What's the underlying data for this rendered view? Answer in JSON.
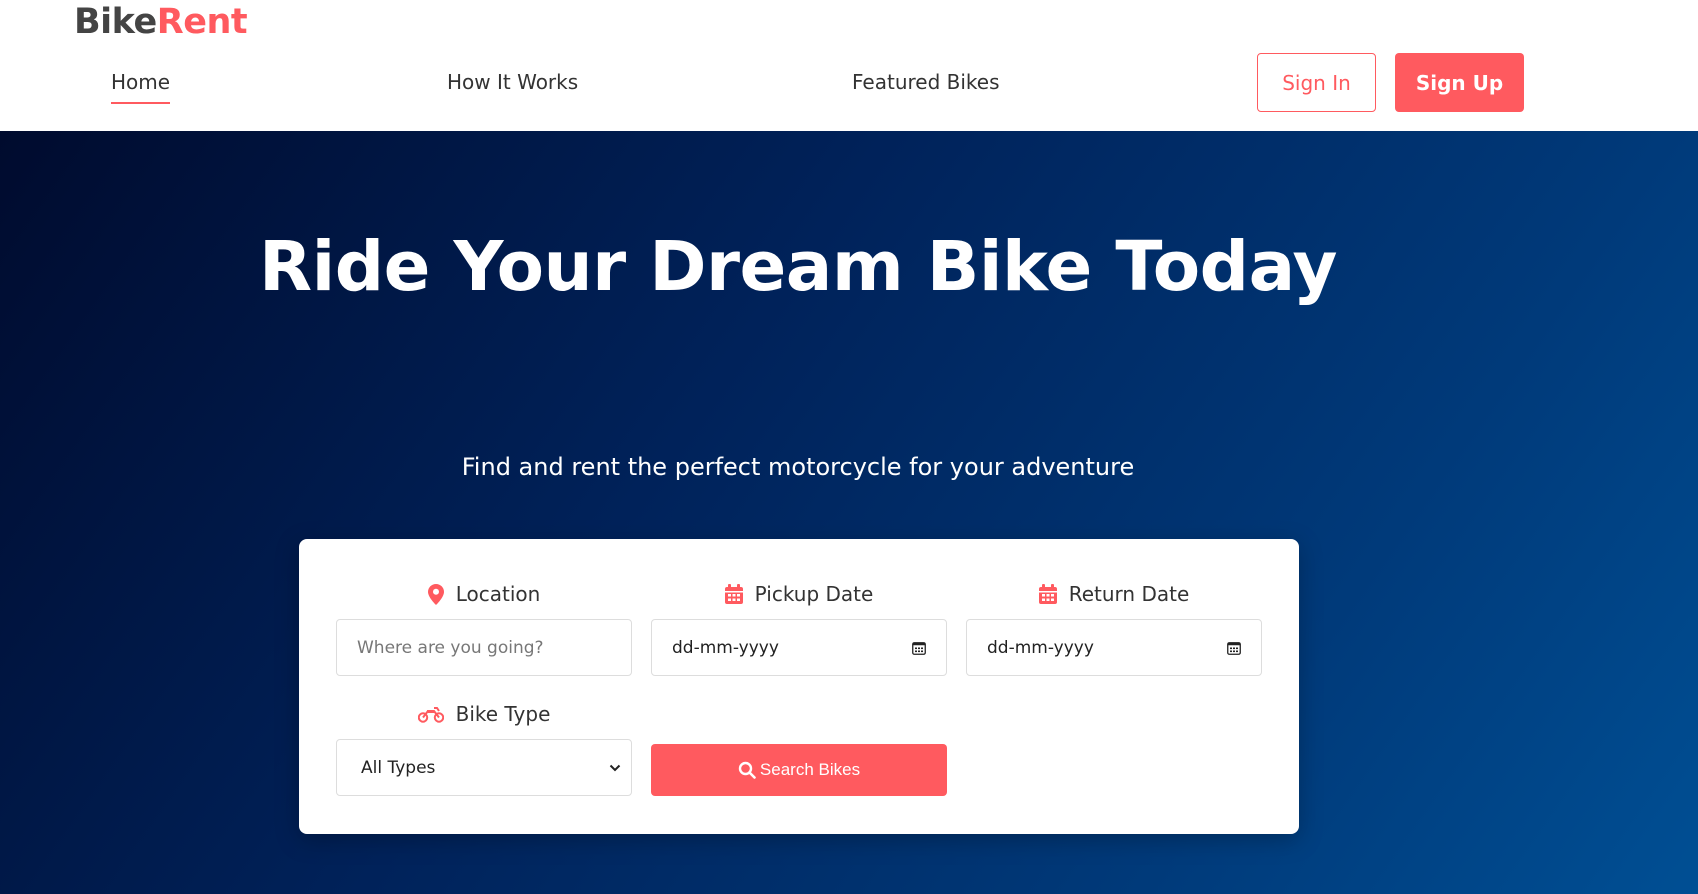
{
  "brand": {
    "part_a": "Bike",
    "part_b": "Rent",
    "accent": "#ff5a5f"
  },
  "nav": {
    "home": "Home",
    "how_it_works": "How It Works",
    "featured_bikes": "Featured Bikes",
    "active": "Home"
  },
  "auth": {
    "sign_in": "Sign In",
    "sign_up": "Sign Up"
  },
  "hero": {
    "title": "Ride Your Dream Bike Today",
    "subtitle": "Find and rent the perfect motorcycle for your adventure"
  },
  "search": {
    "location": {
      "label": "Location",
      "icon": "map-pin-icon",
      "placeholder": "Where are you going?"
    },
    "pickup": {
      "label": "Pickup Date",
      "icon": "calendar-icon",
      "value": "dd-mm-yyyy"
    },
    "return": {
      "label": "Return Date",
      "icon": "calendar-icon",
      "value": "dd-mm-yyyy"
    },
    "bike_type": {
      "label": "Bike Type",
      "icon": "motorcycle-icon",
      "selected": "All Types"
    },
    "button": {
      "label": "Search Bikes",
      "icon": "search-icon"
    }
  }
}
